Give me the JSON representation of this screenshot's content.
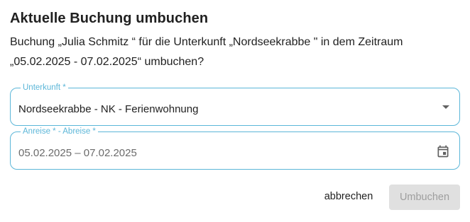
{
  "dialog": {
    "title": "Aktuelle Buchung umbuchen",
    "description": "Buchung „Julia Schmitz “ für die Unterkunft „Nordseekrabbe \" in dem Zeitraum „05.02.2025 - 07.02.2025“ umbuchen?"
  },
  "unterkunft": {
    "label": "Unterkunft *",
    "value": "Nordseekrabbe - NK - Ferienwohnung",
    "icon": "chevron-down-icon"
  },
  "zeitraum": {
    "label": "Anreise * - Abreise *",
    "value": "05.02.2025 – 07.02.2025",
    "icon": "calendar-icon"
  },
  "actions": {
    "cancel_label": "abbrechen",
    "submit_label": "Umbuchen"
  },
  "colors": {
    "accent": "#5bb6d8",
    "disabled_bg": "#e0e0e0",
    "disabled_text": "#9e9e9e"
  }
}
